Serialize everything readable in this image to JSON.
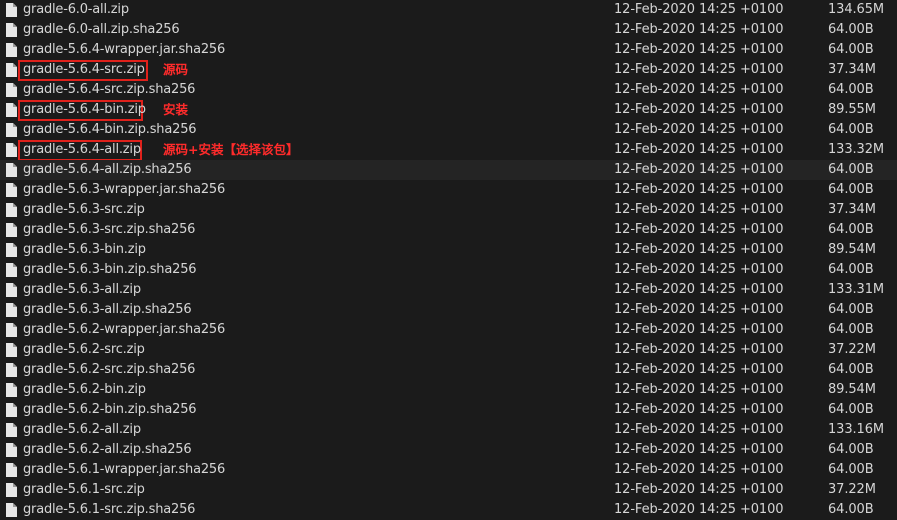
{
  "files": [
    {
      "name": "gradle-6.0-all.zip",
      "date": "12-Feb-2020 14:25 +0100",
      "size": "134.65M"
    },
    {
      "name": "gradle-6.0-all.zip.sha256",
      "date": "12-Feb-2020 14:25 +0100",
      "size": "64.00B"
    },
    {
      "name": "gradle-5.6.4-wrapper.jar.sha256",
      "date": "12-Feb-2020 14:25 +0100",
      "size": "64.00B"
    },
    {
      "name": "gradle-5.6.4-src.zip",
      "date": "12-Feb-2020 14:25 +0100",
      "size": "37.34M"
    },
    {
      "name": "gradle-5.6.4-src.zip.sha256",
      "date": "12-Feb-2020 14:25 +0100",
      "size": "64.00B"
    },
    {
      "name": "gradle-5.6.4-bin.zip",
      "date": "12-Feb-2020 14:25 +0100",
      "size": "89.55M"
    },
    {
      "name": "gradle-5.6.4-bin.zip.sha256",
      "date": "12-Feb-2020 14:25 +0100",
      "size": "64.00B"
    },
    {
      "name": "gradle-5.6.4-all.zip",
      "date": "12-Feb-2020 14:25 +0100",
      "size": "133.32M"
    },
    {
      "name": "gradle-5.6.4-all.zip.sha256",
      "date": "12-Feb-2020 14:25 +0100",
      "size": "64.00B"
    },
    {
      "name": "gradle-5.6.3-wrapper.jar.sha256",
      "date": "12-Feb-2020 14:25 +0100",
      "size": "64.00B"
    },
    {
      "name": "gradle-5.6.3-src.zip",
      "date": "12-Feb-2020 14:25 +0100",
      "size": "37.34M"
    },
    {
      "name": "gradle-5.6.3-src.zip.sha256",
      "date": "12-Feb-2020 14:25 +0100",
      "size": "64.00B"
    },
    {
      "name": "gradle-5.6.3-bin.zip",
      "date": "12-Feb-2020 14:25 +0100",
      "size": "89.54M"
    },
    {
      "name": "gradle-5.6.3-bin.zip.sha256",
      "date": "12-Feb-2020 14:25 +0100",
      "size": "64.00B"
    },
    {
      "name": "gradle-5.6.3-all.zip",
      "date": "12-Feb-2020 14:25 +0100",
      "size": "133.31M"
    },
    {
      "name": "gradle-5.6.3-all.zip.sha256",
      "date": "12-Feb-2020 14:25 +0100",
      "size": "64.00B"
    },
    {
      "name": "gradle-5.6.2-wrapper.jar.sha256",
      "date": "12-Feb-2020 14:25 +0100",
      "size": "64.00B"
    },
    {
      "name": "gradle-5.6.2-src.zip",
      "date": "12-Feb-2020 14:25 +0100",
      "size": "37.22M"
    },
    {
      "name": "gradle-5.6.2-src.zip.sha256",
      "date": "12-Feb-2020 14:25 +0100",
      "size": "64.00B"
    },
    {
      "name": "gradle-5.6.2-bin.zip",
      "date": "12-Feb-2020 14:25 +0100",
      "size": "89.54M"
    },
    {
      "name": "gradle-5.6.2-bin.zip.sha256",
      "date": "12-Feb-2020 14:25 +0100",
      "size": "64.00B"
    },
    {
      "name": "gradle-5.6.2-all.zip",
      "date": "12-Feb-2020 14:25 +0100",
      "size": "133.16M"
    },
    {
      "name": "gradle-5.6.2-all.zip.sha256",
      "date": "12-Feb-2020 14:25 +0100",
      "size": "64.00B"
    },
    {
      "name": "gradle-5.6.1-wrapper.jar.sha256",
      "date": "12-Feb-2020 14:25 +0100",
      "size": "64.00B"
    },
    {
      "name": "gradle-5.6.1-src.zip",
      "date": "12-Feb-2020 14:25 +0100",
      "size": "37.22M"
    },
    {
      "name": "gradle-5.6.1-src.zip.sha256",
      "date": "12-Feb-2020 14:25 +0100",
      "size": "64.00B"
    }
  ],
  "annotations": {
    "src_note": "源码",
    "bin_note": "安装",
    "all_note": "源码+安装【选择该包】"
  },
  "colors": {
    "background": "#1b1b1b",
    "text": "#d6d6d6",
    "annotation_red": "#e0211b",
    "hover_row": "#242424"
  },
  "icon": "file-icon"
}
